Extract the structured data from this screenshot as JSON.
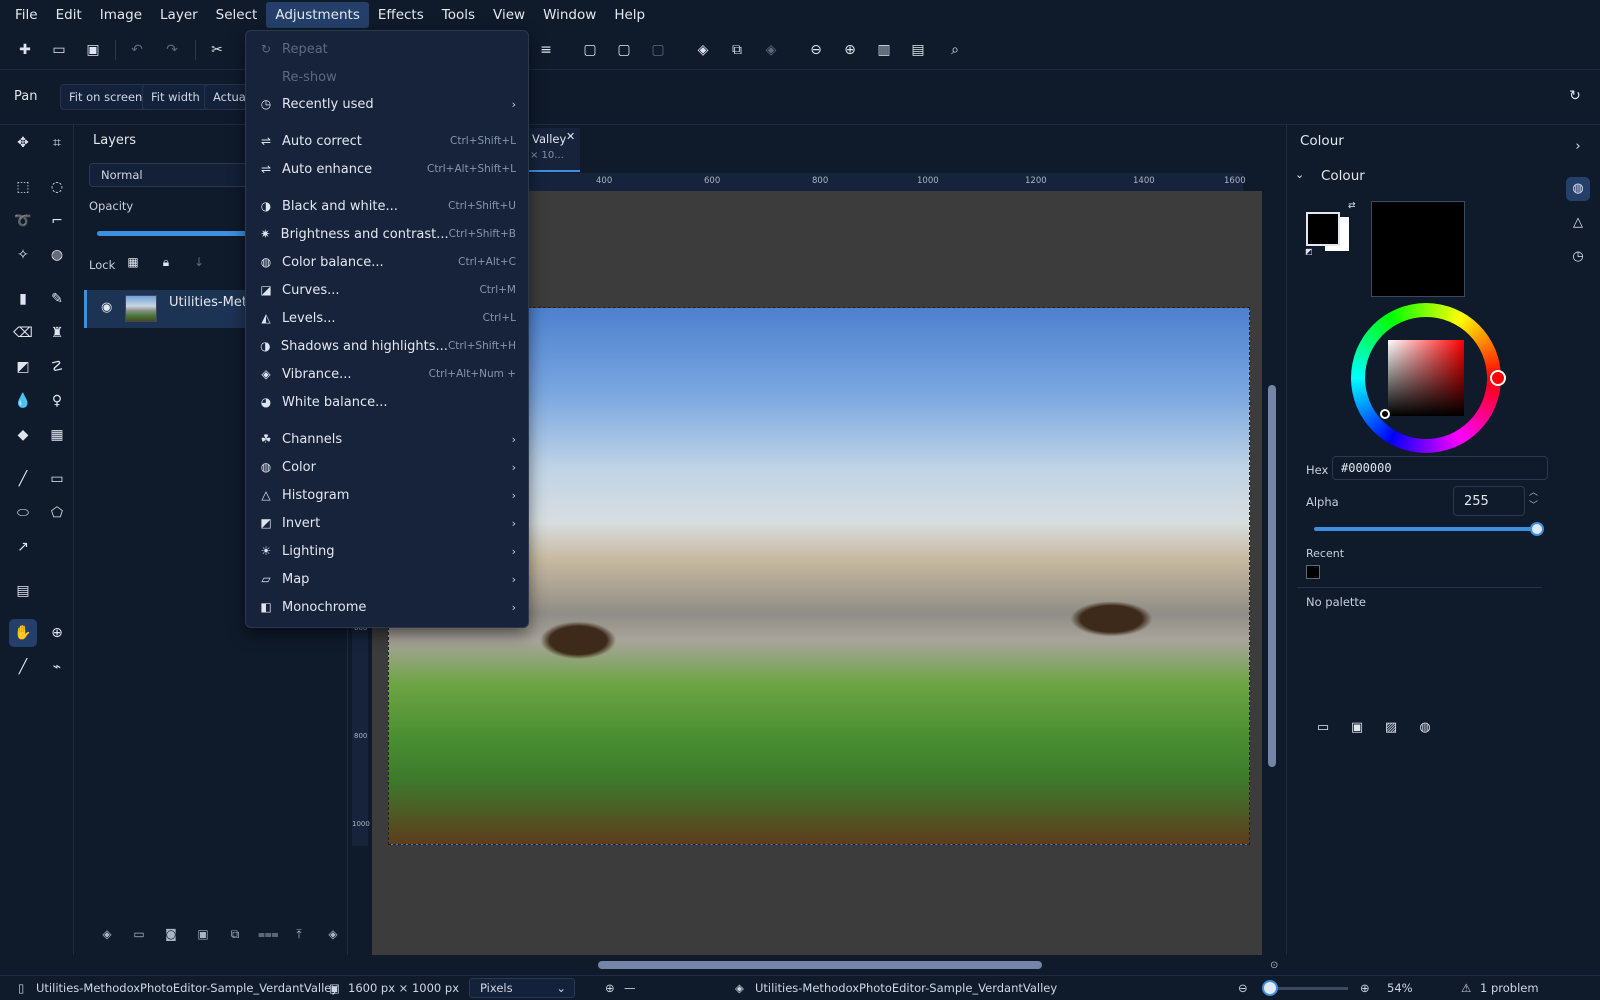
{
  "menubar": [
    "File",
    "Edit",
    "Image",
    "Layer",
    "Select",
    "Adjustments",
    "Effects",
    "Tools",
    "View",
    "Window",
    "Help"
  ],
  "toolbar_icons": [
    "new-icon",
    "open-icon",
    "save-icon",
    "undo-icon",
    "redo-icon",
    "cut-icon"
  ],
  "toolbar_icons_right": [
    "align-icon",
    "select-all-icon",
    "deselect-icon",
    "invert-selection-icon",
    "layers-icon",
    "duplicate-icon",
    "merge-icon",
    "zoom-out-icon",
    "zoom-in-icon",
    "fit-width-icon",
    "actual-size-icon",
    "search-icon"
  ],
  "options": {
    "tool": "Pan",
    "buttons": [
      "Fit on screen",
      "Fit width",
      "Actual"
    ]
  },
  "layers": {
    "title": "Layers",
    "blend_mode": "Normal",
    "opacity_label": "Opacity",
    "opacity_value": 1.0,
    "lock_label": "Lock",
    "layer_name": "Utilities-Metho"
  },
  "document": {
    "tab_title": "Valley",
    "tab_size": "× 10...",
    "ruler_top": [
      "400",
      "600",
      "800",
      "1000",
      "1200",
      "1400",
      "1600"
    ],
    "ruler_left": [
      "600",
      "800",
      "1000"
    ]
  },
  "adjustments_menu": [
    {
      "icon": "repeat-icon",
      "label": "Repeat",
      "shortcut": "",
      "disabled": true,
      "submenu": false
    },
    {
      "icon": "",
      "label": "Re-show",
      "shortcut": "",
      "disabled": true,
      "submenu": false
    },
    {
      "icon": "clock-icon",
      "label": "Recently used",
      "shortcut": "",
      "disabled": false,
      "submenu": true
    },
    {
      "icon": "sliders-icon",
      "label": "Auto correct",
      "shortcut": "Ctrl+Shift+L",
      "disabled": false,
      "submenu": false
    },
    {
      "icon": "sliders-icon",
      "label": "Auto enhance",
      "shortcut": "Ctrl+Alt+Shift+L",
      "disabled": false,
      "submenu": false
    },
    {
      "icon": "half-circle-icon",
      "label": "Black and white...",
      "shortcut": "Ctrl+Shift+U",
      "disabled": false,
      "submenu": false
    },
    {
      "icon": "sun-icon",
      "label": "Brightness and contrast...",
      "shortcut": "Ctrl+Shift+B",
      "disabled": false,
      "submenu": false
    },
    {
      "icon": "palette-icon",
      "label": "Color balance...",
      "shortcut": "Ctrl+Alt+C",
      "disabled": false,
      "submenu": false
    },
    {
      "icon": "curves-icon",
      "label": "Curves...",
      "shortcut": "Ctrl+M",
      "disabled": false,
      "submenu": false
    },
    {
      "icon": "levels-icon",
      "label": "Levels...",
      "shortcut": "Ctrl+L",
      "disabled": false,
      "submenu": false
    },
    {
      "icon": "half-circle-icon",
      "label": "Shadows and highlights...",
      "shortcut": "Ctrl+Shift+H",
      "disabled": false,
      "submenu": false
    },
    {
      "icon": "drop-icon",
      "label": "Vibrance...",
      "shortcut": "Ctrl+Alt+Num +",
      "disabled": false,
      "submenu": false
    },
    {
      "icon": "white-balance-icon",
      "label": "White balance...",
      "shortcut": "",
      "disabled": false,
      "submenu": false
    },
    {
      "icon": "channels-icon",
      "label": "Channels",
      "shortcut": "",
      "disabled": false,
      "submenu": true
    },
    {
      "icon": "palette-icon",
      "label": "Color",
      "shortcut": "",
      "disabled": false,
      "submenu": true
    },
    {
      "icon": "histogram-icon",
      "label": "Histogram",
      "shortcut": "",
      "disabled": false,
      "submenu": true
    },
    {
      "icon": "invert-icon",
      "label": "Invert",
      "shortcut": "",
      "disabled": false,
      "submenu": true
    },
    {
      "icon": "lighting-icon",
      "label": "Lighting",
      "shortcut": "",
      "disabled": false,
      "submenu": true
    },
    {
      "icon": "map-icon",
      "label": "Map",
      "shortcut": "",
      "disabled": false,
      "submenu": true
    },
    {
      "icon": "monochrome-icon",
      "label": "Monochrome",
      "shortcut": "",
      "disabled": false,
      "submenu": true
    }
  ],
  "colour": {
    "panel_title": "Colour",
    "section_title": "Colour",
    "primary": "#000000",
    "secondary": "#ffffff",
    "hex_label": "Hex",
    "hex_value": "#000000",
    "alpha_label": "Alpha",
    "alpha_value": "255",
    "recent_label": "Recent",
    "no_palette": "No palette"
  },
  "status": {
    "file": "Utilities-MethodoxPhotoEditor-Sample_VerdantValley",
    "size": "1600 px × 1000 px",
    "units": "Pixels",
    "cursor": "—",
    "layer": "Utilities-MethodoxPhotoEditor-Sample_VerdantValley",
    "zoom": "54%",
    "problems": "1 problem"
  }
}
